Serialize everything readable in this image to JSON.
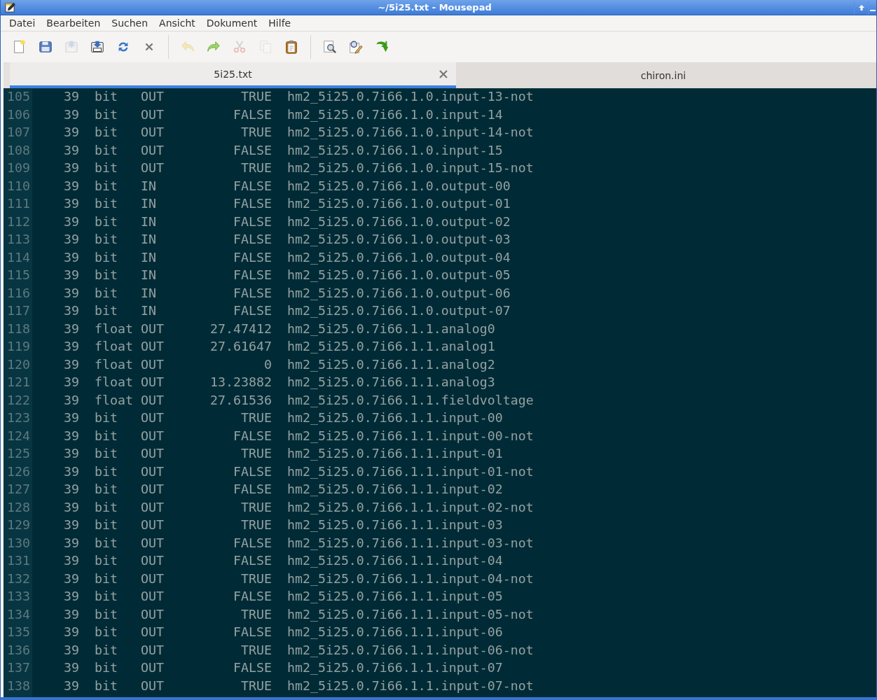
{
  "window": {
    "title": "~/5i25.txt - Mousepad"
  },
  "menu": [
    "Datei",
    "Bearbeiten",
    "Suchen",
    "Ansicht",
    "Dokument",
    "Hilfe"
  ],
  "toolbar": [
    {
      "kind": "new",
      "disabled": false
    },
    {
      "kind": "save",
      "disabled": false
    },
    {
      "kind": "saveas",
      "disabled": true
    },
    {
      "kind": "saveall",
      "disabled": false
    },
    {
      "kind": "reload",
      "disabled": false
    },
    {
      "kind": "close",
      "disabled": false
    },
    {
      "kind": "sep"
    },
    {
      "kind": "undo",
      "disabled": true
    },
    {
      "kind": "redo",
      "disabled": false
    },
    {
      "kind": "cut",
      "disabled": true
    },
    {
      "kind": "copy",
      "disabled": true
    },
    {
      "kind": "paste",
      "disabled": false
    },
    {
      "kind": "sep"
    },
    {
      "kind": "find",
      "disabled": false
    },
    {
      "kind": "replace",
      "disabled": false
    },
    {
      "kind": "goto",
      "disabled": false
    }
  ],
  "tabs": [
    {
      "label": "5i25.txt",
      "selected": true
    },
    {
      "label": "chiron.ini",
      "selected": false
    }
  ],
  "lines": [
    {
      "number": "105",
      "text": "   39  bit   OUT          TRUE  hm2_5i25.0.7i66.1.0.input-13-not"
    },
    {
      "number": "106",
      "text": "   39  bit   OUT         FALSE  hm2_5i25.0.7i66.1.0.input-14"
    },
    {
      "number": "107",
      "text": "   39  bit   OUT          TRUE  hm2_5i25.0.7i66.1.0.input-14-not"
    },
    {
      "number": "108",
      "text": "   39  bit   OUT         FALSE  hm2_5i25.0.7i66.1.0.input-15"
    },
    {
      "number": "109",
      "text": "   39  bit   OUT          TRUE  hm2_5i25.0.7i66.1.0.input-15-not"
    },
    {
      "number": "110",
      "text": "   39  bit   IN          FALSE  hm2_5i25.0.7i66.1.0.output-00"
    },
    {
      "number": "111",
      "text": "   39  bit   IN          FALSE  hm2_5i25.0.7i66.1.0.output-01"
    },
    {
      "number": "112",
      "text": "   39  bit   IN          FALSE  hm2_5i25.0.7i66.1.0.output-02"
    },
    {
      "number": "113",
      "text": "   39  bit   IN          FALSE  hm2_5i25.0.7i66.1.0.output-03"
    },
    {
      "number": "114",
      "text": "   39  bit   IN          FALSE  hm2_5i25.0.7i66.1.0.output-04"
    },
    {
      "number": "115",
      "text": "   39  bit   IN          FALSE  hm2_5i25.0.7i66.1.0.output-05"
    },
    {
      "number": "116",
      "text": "   39  bit   IN          FALSE  hm2_5i25.0.7i66.1.0.output-06"
    },
    {
      "number": "117",
      "text": "   39  bit   IN          FALSE  hm2_5i25.0.7i66.1.0.output-07"
    },
    {
      "number": "118",
      "text": "   39  float OUT      27.47412  hm2_5i25.0.7i66.1.1.analog0"
    },
    {
      "number": "119",
      "text": "   39  float OUT      27.61647  hm2_5i25.0.7i66.1.1.analog1"
    },
    {
      "number": "120",
      "text": "   39  float OUT             0  hm2_5i25.0.7i66.1.1.analog2"
    },
    {
      "number": "121",
      "text": "   39  float OUT      13.23882  hm2_5i25.0.7i66.1.1.analog3"
    },
    {
      "number": "122",
      "text": "   39  float OUT      27.61536  hm2_5i25.0.7i66.1.1.fieldvoltage"
    },
    {
      "number": "123",
      "text": "   39  bit   OUT          TRUE  hm2_5i25.0.7i66.1.1.input-00"
    },
    {
      "number": "124",
      "text": "   39  bit   OUT         FALSE  hm2_5i25.0.7i66.1.1.input-00-not"
    },
    {
      "number": "125",
      "text": "   39  bit   OUT          TRUE  hm2_5i25.0.7i66.1.1.input-01"
    },
    {
      "number": "126",
      "text": "   39  bit   OUT         FALSE  hm2_5i25.0.7i66.1.1.input-01-not"
    },
    {
      "number": "127",
      "text": "   39  bit   OUT         FALSE  hm2_5i25.0.7i66.1.1.input-02"
    },
    {
      "number": "128",
      "text": "   39  bit   OUT          TRUE  hm2_5i25.0.7i66.1.1.input-02-not"
    },
    {
      "number": "129",
      "text": "   39  bit   OUT          TRUE  hm2_5i25.0.7i66.1.1.input-03"
    },
    {
      "number": "130",
      "text": "   39  bit   OUT         FALSE  hm2_5i25.0.7i66.1.1.input-03-not"
    },
    {
      "number": "131",
      "text": "   39  bit   OUT         FALSE  hm2_5i25.0.7i66.1.1.input-04"
    },
    {
      "number": "132",
      "text": "   39  bit   OUT          TRUE  hm2_5i25.0.7i66.1.1.input-04-not"
    },
    {
      "number": "133",
      "text": "   39  bit   OUT         FALSE  hm2_5i25.0.7i66.1.1.input-05"
    },
    {
      "number": "134",
      "text": "   39  bit   OUT          TRUE  hm2_5i25.0.7i66.1.1.input-05-not"
    },
    {
      "number": "135",
      "text": "   39  bit   OUT         FALSE  hm2_5i25.0.7i66.1.1.input-06"
    },
    {
      "number": "136",
      "text": "   39  bit   OUT          TRUE  hm2_5i25.0.7i66.1.1.input-06-not"
    },
    {
      "number": "137",
      "text": "   39  bit   OUT         FALSE  hm2_5i25.0.7i66.1.1.input-07"
    },
    {
      "number": "138",
      "text": "   39  bit   OUT          TRUE  hm2_5i25.0.7i66.1.1.input-07-not"
    }
  ]
}
